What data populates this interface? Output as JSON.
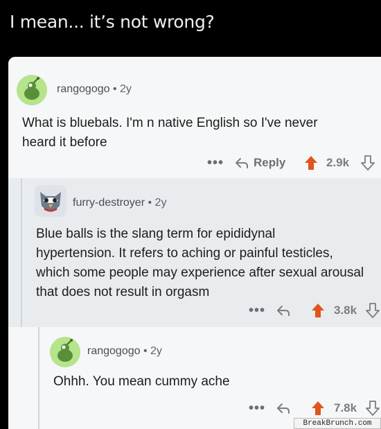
{
  "post": {
    "title": "I mean... it’s not wrong?"
  },
  "comments": [
    {
      "username": "rangogogo",
      "age": "2y",
      "separator": "•",
      "text_lines": [
        "What is bluebals. I'm n native English so I've never",
        "heard it before"
      ],
      "actions": {
        "more": "•••",
        "reply": "Reply",
        "score": "2.9k"
      }
    },
    {
      "username": "furry-destroyer",
      "age": "2y",
      "separator": "•",
      "text_lines": [
        "Blue balls is the slang term for epididynal",
        "hypertension. It refers to aching or painful testicles,",
        "which some people may experience after sexual arousal",
        "that does not result in orgasm"
      ],
      "actions": {
        "more": "•••",
        "score": "3.8k"
      }
    },
    {
      "username": "rangogogo",
      "age": "2y",
      "separator": "•",
      "text_lines": [
        "Ohhh. You mean cummy ache"
      ],
      "actions": {
        "more": "•••",
        "score": "7.8k"
      }
    }
  ],
  "watermark": "BreakBrunch.com",
  "colors": {
    "upvote": "#e0551d",
    "avatar_green": "#b5e48c",
    "reply_bg": "#e8ecef"
  },
  "icons": [
    "snoo-avatar-icon",
    "owl-avatar-icon",
    "reply-arrow-icon",
    "upvote-arrow-icon",
    "downvote-arrow-icon",
    "more-dots-icon"
  ]
}
